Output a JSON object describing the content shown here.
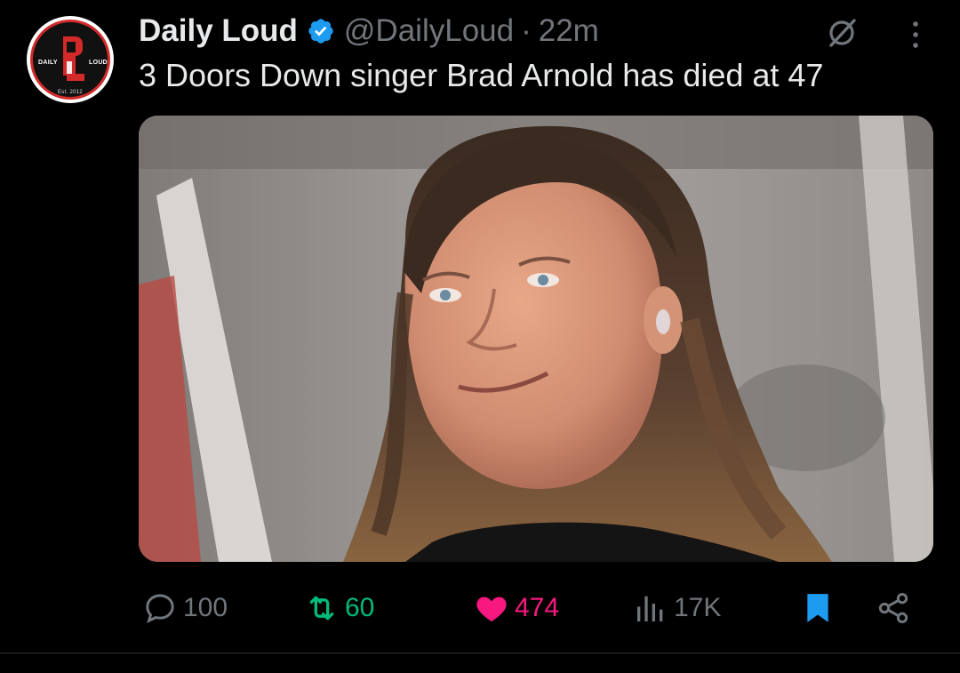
{
  "tweet": {
    "author_name": "Daily Loud",
    "handle": "@DailyLoud",
    "separator": "·",
    "time": "22m",
    "text": "3 Doors Down singer Brad Arnold has died at 47",
    "avatar": {
      "left_label": "DAILY",
      "right_label": "LOUD",
      "bottom_label": "Est. 2012"
    }
  },
  "actions": {
    "reply_count": "100",
    "retweet_count": "60",
    "like_count": "474",
    "views_count": "17K"
  },
  "icons": {
    "verified": "verified-badge-icon",
    "grok": "grok-icon",
    "more": "more-icon",
    "reply": "reply-icon",
    "retweet": "retweet-icon",
    "like": "heart-icon",
    "views": "views-icon",
    "bookmark": "bookmark-icon",
    "share": "share-icon"
  },
  "colors": {
    "background": "#000000",
    "text": "#e7e9ea",
    "muted": "#71767b",
    "verified": "#1d9bf0",
    "retweet": "#00ba7c",
    "like": "#f91880",
    "bookmark": "#1d9bf0"
  }
}
